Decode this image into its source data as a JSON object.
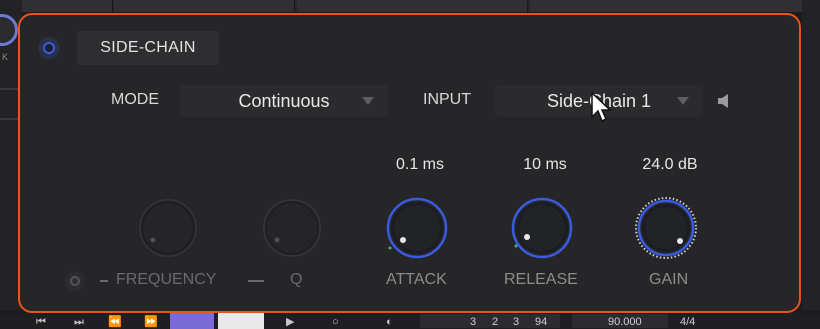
{
  "panel": {
    "title": "SIDE-CHAIN",
    "accent_color": "#e8531e",
    "power_color": "#3a5be0"
  },
  "mode": {
    "label": "MODE",
    "value": "Continuous"
  },
  "input": {
    "label": "INPUT",
    "value": "Side-Chain 1"
  },
  "knobs": {
    "frequency": {
      "label": "FREQUENCY",
      "enabled": false
    },
    "q": {
      "label": "Q",
      "enabled": false
    },
    "attack": {
      "label": "ATTACK",
      "value": "0.1 ms"
    },
    "release": {
      "label": "RELEASE",
      "value": "10 ms"
    },
    "gain": {
      "label": "GAIN",
      "value": "24.0 dB"
    }
  },
  "host": {
    "left_tick": "K",
    "position": {
      "bars": "3",
      "beats": "2",
      "div": "3",
      "ticks": "94"
    },
    "tempo": "90.000",
    "signature": "4/4"
  },
  "icons": [
    "power-icon",
    "dropdown-arrow-icon",
    "speaker-icon",
    "mouse-pointer-icon"
  ]
}
